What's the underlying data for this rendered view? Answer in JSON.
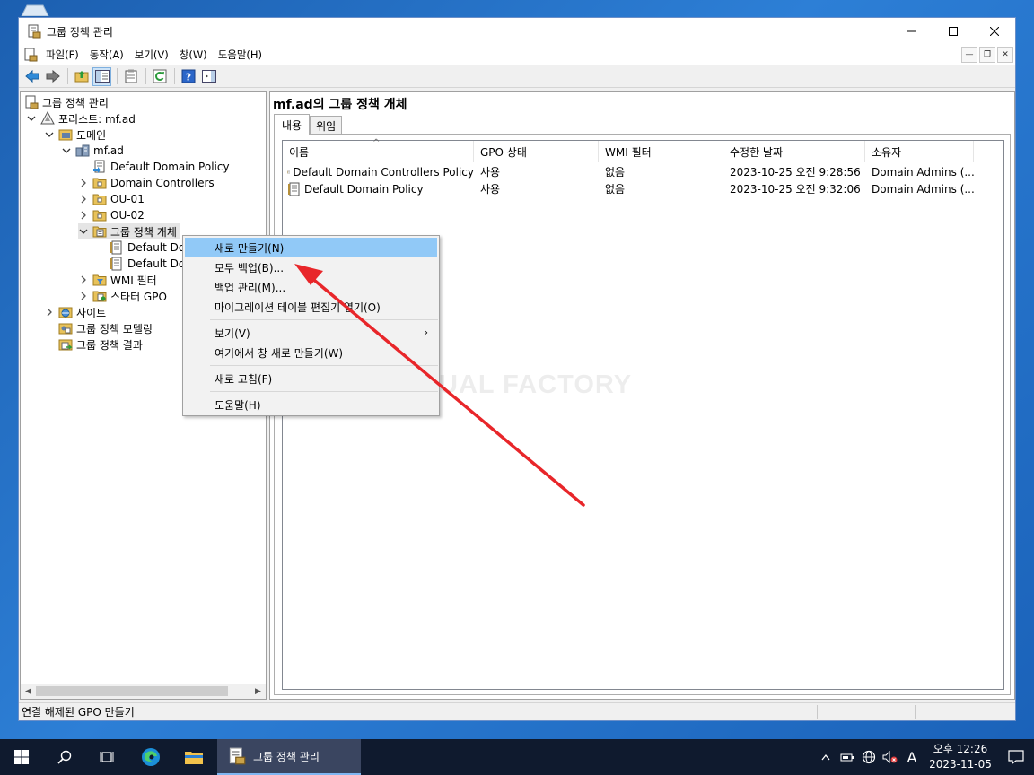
{
  "window": {
    "title": "그룹 정책 관리",
    "controls": {
      "minimize": "—",
      "maximize": "☐",
      "close": "✕"
    }
  },
  "menu": {
    "items": [
      "파일(F)",
      "동작(A)",
      "보기(V)",
      "창(W)",
      "도움말(H)"
    ]
  },
  "tree": {
    "items": [
      {
        "label": "그룹 정책 관리",
        "icon": "gpm-icon"
      },
      {
        "label": "포리스트: mf.ad",
        "icon": "forest-icon"
      },
      {
        "label": "도메인",
        "icon": "domains-icon"
      },
      {
        "label": "mf.ad",
        "icon": "domain-icon"
      },
      {
        "label": "Default Domain Policy",
        "icon": "gpo-link-icon"
      },
      {
        "label": "Domain Controllers",
        "icon": "ou-folder-icon"
      },
      {
        "label": "OU-01",
        "icon": "ou-folder-icon"
      },
      {
        "label": "OU-02",
        "icon": "ou-folder-icon"
      },
      {
        "label": "그룹 정책 개체",
        "icon": "gpo-container-icon"
      },
      {
        "label": "Default Dor",
        "icon": "gpo-icon"
      },
      {
        "label": "Default Dor",
        "icon": "gpo-icon"
      },
      {
        "label": "WMI 필터",
        "icon": "wmi-folder-icon"
      },
      {
        "label": "스타터 GPO",
        "icon": "starter-gpo-icon"
      },
      {
        "label": "사이트",
        "icon": "sites-icon"
      },
      {
        "label": "그룹 정책 모델링",
        "icon": "modeling-icon"
      },
      {
        "label": "그룹 정책 결과",
        "icon": "results-icon"
      }
    ]
  },
  "right": {
    "title": "mf.ad의 그룹 정책 개체",
    "tabs": [
      "내용",
      "위임"
    ],
    "columns": [
      "이름",
      "GPO 상태",
      "WMI 필터",
      "수정한 날짜",
      "소유자"
    ],
    "rows": [
      {
        "name": "Default Domain Controllers Policy",
        "status": "사용",
        "wmi": "없음",
        "modified": "2023-10-25 오전 9:28:56",
        "owner": "Domain Admins (..."
      },
      {
        "name": "Default Domain Policy",
        "status": "사용",
        "wmi": "없음",
        "modified": "2023-10-25 오전 9:32:06",
        "owner": "Domain Admins (..."
      }
    ],
    "watermark": "MANUAL FACTORY"
  },
  "context_menu": {
    "items": [
      {
        "label": "새로 만들기(N)",
        "highlighted": true
      },
      {
        "label": "모두 백업(B)..."
      },
      {
        "label": "백업 관리(M)..."
      },
      {
        "label": "마이그레이션 테이블 편집기 열기(O)"
      },
      {
        "label": "보기(V)",
        "submenu": "›"
      },
      {
        "label": "여기에서 창 새로 만들기(W)"
      },
      {
        "label": "새로 고침(F)"
      },
      {
        "label": "도움말(H)"
      }
    ]
  },
  "status": {
    "text": "연결 해제된 GPO 만들기"
  },
  "taskbar": {
    "app_label": "그룹 정책 관리",
    "ime": "A",
    "time": "오후 12:26",
    "date": "2023-11-05"
  },
  "colors": {
    "highlight": "#91c9f7",
    "arrow": "#e8262a",
    "taskbar": "#0f1a2e"
  }
}
